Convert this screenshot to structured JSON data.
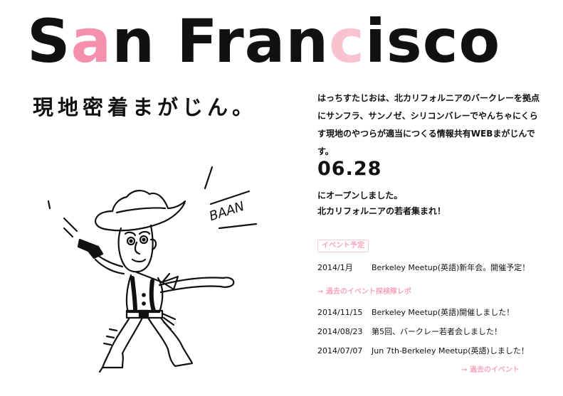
{
  "header": {
    "title_part1": "S",
    "title_a": "a",
    "title_part2": "n Fran",
    "title_c": "c",
    "title_part3": "isco",
    "subtitle": "現地密着まがじん。"
  },
  "illustration": {
    "sound_text": "BAAN"
  },
  "intro": {
    "text": "はっちすたじおは、北カリフォルニアのバークレーを拠点にサンフラ、サンノゼ、シリコンバレーでやんちゃにくらす現地のやつらが適当につくる情報共有WEBまがじんです。",
    "open_date": "06.28",
    "opened_line1": "にオープンしました。",
    "opened_line2": "北カリフォルニアの若者集まれ！"
  },
  "events": {
    "badge_label": "イベント予定",
    "upcoming": [
      {
        "date": "2014/1月",
        "title": "Berkeley Meetup(英語)新年会。開催予定！"
      }
    ],
    "past_link_label": "→ 過去のイベント探検隊レポ",
    "past": [
      {
        "date": "2014/11/15",
        "title": "Berkeley Meetup(英語)開催しました！"
      },
      {
        "date": "2014/08/23",
        "title": "第5回、バークレー若者会しました！"
      },
      {
        "date": "2014/07/07",
        "title": "Jun 7th-Berkeley Meetup(英語)しました！"
      }
    ],
    "more_link_label": "→ 過去のイベント"
  },
  "colors": {
    "accent_pink": "#f58fae",
    "light_pink": "#f9c2d0",
    "text": "#111111"
  }
}
